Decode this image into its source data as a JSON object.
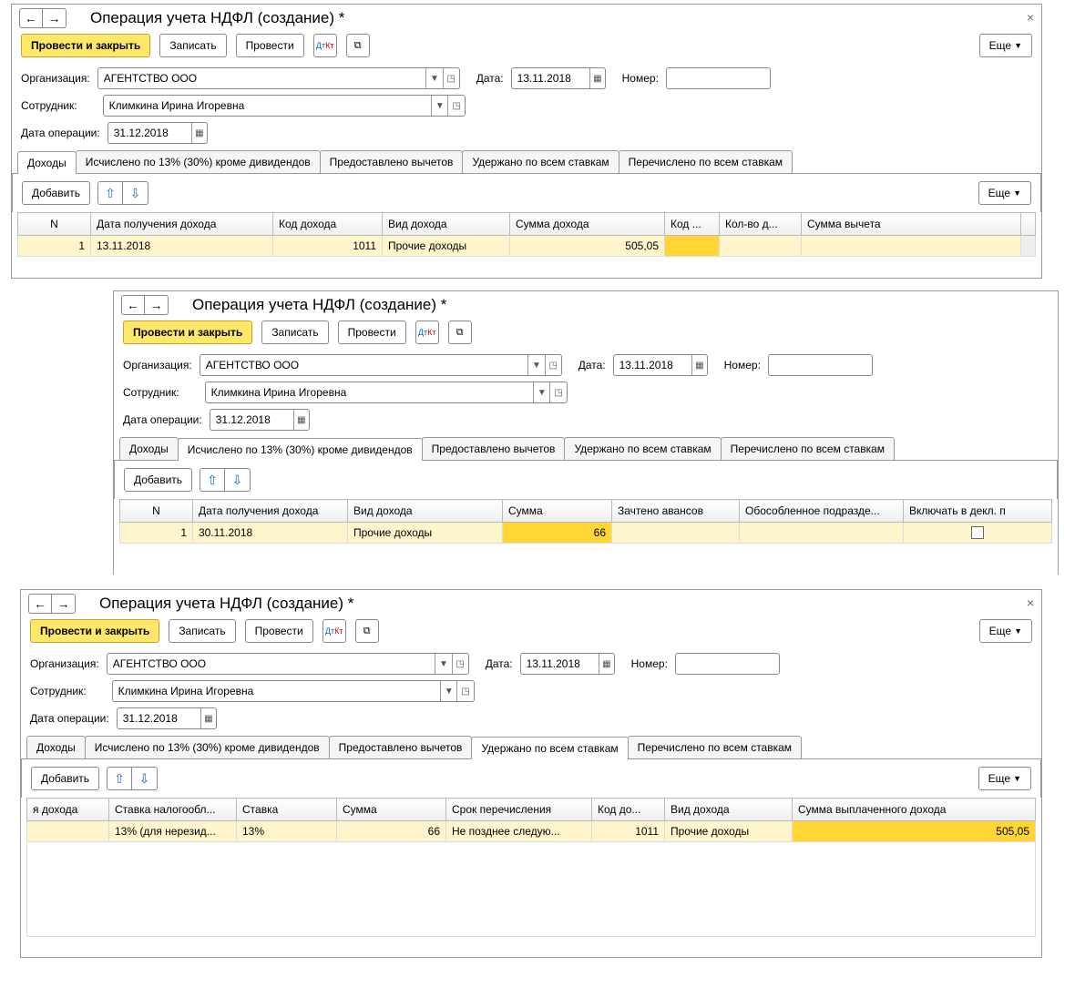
{
  "common": {
    "title": "Операция учета НДФЛ (создание) *",
    "btn_post_close": "Провести и закрыть",
    "btn_save": "Записать",
    "btn_post": "Провести",
    "btn_more": "Еще",
    "btn_add": "Добавить",
    "lbl_org": "Организация:",
    "lbl_emp": "Сотрудник:",
    "lbl_opdate": "Дата операции:",
    "lbl_date": "Дата:",
    "lbl_number": "Номер:",
    "val_org": "АГЕНТСТВО ООО",
    "val_emp": "Климкина Ирина Игоревна",
    "val_opdate": "31.12.2018",
    "val_date": "13.11.2018",
    "tabs": {
      "t1": "Доходы",
      "t2": "Исчислено по 13% (30%) кроме дивидендов",
      "t3": "Предоставлено вычетов",
      "t4": "Удержано по всем ставкам",
      "t5": "Перечислено по всем ставкам"
    }
  },
  "p1": {
    "cols": {
      "c1": "N",
      "c2": "Дата получения дохода",
      "c3": "Код дохода",
      "c4": "Вид дохода",
      "c5": "Сумма дохода",
      "c6": "Код ...",
      "c7": "Кол-во д...",
      "c8": "Сумма вычета"
    },
    "row": {
      "n": "1",
      "date": "13.11.2018",
      "code": "1011",
      "kind": "Прочие доходы",
      "sum": "505,05"
    }
  },
  "p2": {
    "cols": {
      "c1": "N",
      "c2": "Дата получения дохода",
      "c3": "Вид дохода",
      "c4": "Сумма",
      "c5": "Зачтено авансов",
      "c6": "Обособленное подразде...",
      "c7": "Включать в декл. п"
    },
    "row": {
      "n": "1",
      "date": "30.11.2018",
      "kind": "Прочие доходы",
      "sum": "66"
    }
  },
  "p3": {
    "cols": {
      "c1": "я дохода",
      "c2": "Ставка налогообл...",
      "c3": "Ставка",
      "c4": "Сумма",
      "c5": "Срок перечисления",
      "c6": "Код до...",
      "c7": "Вид дохода",
      "c8": "Сумма выплаченного дохода"
    },
    "row": {
      "rate_name": "13% (для нерезид...",
      "rate": "13%",
      "sum": "66",
      "term": "Не позднее следую...",
      "code": "1011",
      "kind": "Прочие доходы",
      "paid": "505,05"
    }
  }
}
